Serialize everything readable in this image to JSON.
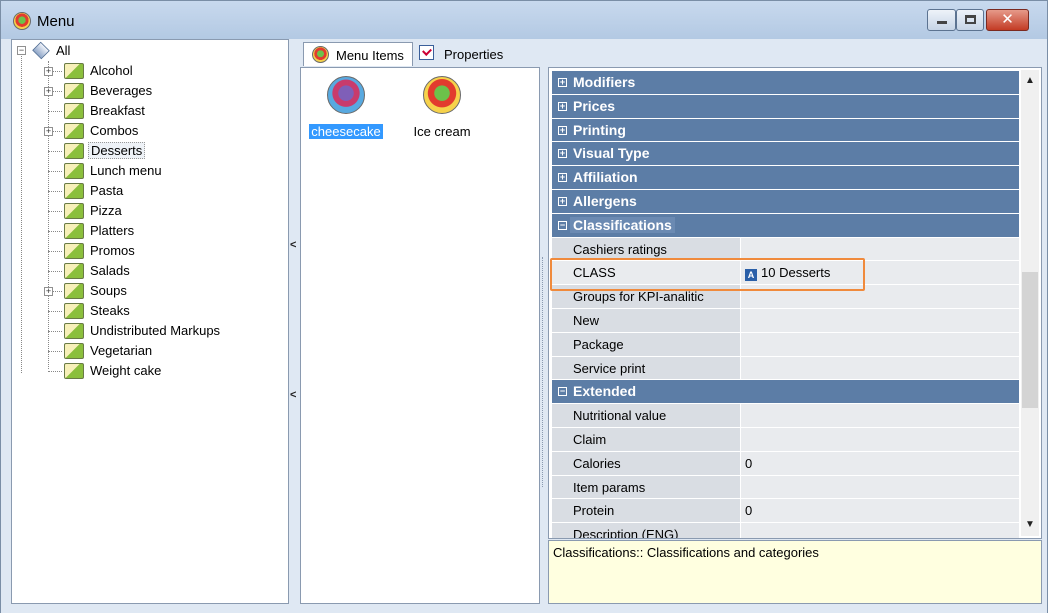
{
  "window": {
    "title": "Menu",
    "close_glyph": "✕"
  },
  "tree": {
    "root_label": "All",
    "items": [
      {
        "label": "Alcohol",
        "expandable": true
      },
      {
        "label": "Beverages",
        "expandable": true
      },
      {
        "label": "Breakfast",
        "expandable": false
      },
      {
        "label": "Combos",
        "expandable": true
      },
      {
        "label": "Desserts",
        "expandable": false,
        "selected": true
      },
      {
        "label": "Lunch menu",
        "expandable": false
      },
      {
        "label": "Pasta",
        "expandable": false
      },
      {
        "label": "Pizza",
        "expandable": false
      },
      {
        "label": "Platters",
        "expandable": false
      },
      {
        "label": "Promos",
        "expandable": false
      },
      {
        "label": "Salads",
        "expandable": false
      },
      {
        "label": "Soups",
        "expandable": true
      },
      {
        "label": "Steaks",
        "expandable": false
      },
      {
        "label": "Undistributed Markups",
        "expandable": false
      },
      {
        "label": "Vegetarian",
        "expandable": false
      },
      {
        "label": "Weight cake",
        "expandable": false
      }
    ]
  },
  "tabs": {
    "menu_items": "Menu Items",
    "properties": "Properties"
  },
  "menu_items": [
    {
      "label": "cheesecake",
      "selected": true
    },
    {
      "label": "Ice cream",
      "selected": false
    }
  ],
  "properties": {
    "categories": [
      {
        "name": "Modifiers",
        "expanded": false,
        "rows": []
      },
      {
        "name": "Prices",
        "expanded": false,
        "rows": []
      },
      {
        "name": "Printing",
        "expanded": false,
        "rows": []
      },
      {
        "name": "Visual Type",
        "expanded": false,
        "rows": []
      },
      {
        "name": "Affiliation",
        "expanded": false,
        "rows": []
      },
      {
        "name": "Allergens",
        "expanded": false,
        "rows": []
      },
      {
        "name": "Classifications",
        "expanded": true,
        "active": true,
        "rows": [
          {
            "name": "Cashiers ratings",
            "value": ""
          },
          {
            "name": "CLASS",
            "value": "10 Desserts",
            "icon": "A",
            "highlighted": true
          },
          {
            "name": "Groups for KPI-analitic",
            "value": ""
          },
          {
            "name": "New",
            "value": ""
          },
          {
            "name": "Package",
            "value": ""
          },
          {
            "name": "Service print",
            "value": ""
          }
        ]
      },
      {
        "name": "Extended",
        "expanded": true,
        "rows": [
          {
            "name": "Nutritional value",
            "value": ""
          },
          {
            "name": "Claim",
            "value": ""
          },
          {
            "name": "Calories",
            "value": "0"
          },
          {
            "name": "Item params",
            "value": ""
          },
          {
            "name": "Protein",
            "value": "0"
          },
          {
            "name": "Description (ENG)",
            "value": ""
          }
        ]
      }
    ],
    "description": "Classifications:: Classifications and categories"
  },
  "scrollbar": {
    "up": "▲",
    "down": "▼"
  },
  "splitter_arrows": [
    "<",
    "<"
  ]
}
